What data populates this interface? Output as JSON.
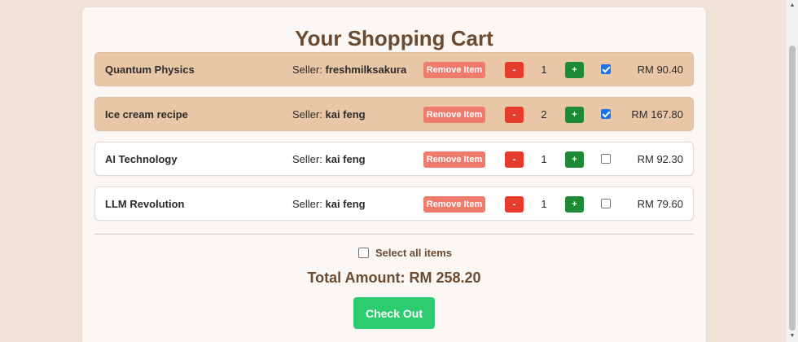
{
  "cart": {
    "title": "Your Shopping Cart",
    "seller_prefix": "Seller:",
    "remove_label": "Remove Item",
    "minus_label": "-",
    "plus_label": "+",
    "items": [
      {
        "name": "Quantum Physics",
        "seller": "freshmilksakura",
        "quantity": "1",
        "price": "RM 90.40",
        "selected": true
      },
      {
        "name": "Ice cream recipe",
        "seller": "kai feng",
        "quantity": "2",
        "price": "RM 167.80",
        "selected": true
      },
      {
        "name": "AI Technology",
        "seller": "kai feng",
        "quantity": "1",
        "price": "RM 92.30",
        "selected": false
      },
      {
        "name": "LLM Revolution",
        "seller": "kai feng",
        "quantity": "1",
        "price": "RM 79.60",
        "selected": false
      }
    ],
    "select_all_label": "Select all items",
    "select_all_checked": false,
    "total_label": "Total Amount: RM 258.20",
    "checkout_label": "Check Out"
  },
  "colors": {
    "page_background": "#f1e4d8",
    "selected_row": "#e8c6a6",
    "heading_brown": "#6b4a2f",
    "remove_button": "#ee7b6c",
    "minus_button": "#e53c2e",
    "plus_button": "#1f8a36",
    "checkout_button": "#2ecc71",
    "checkbox_checked": "#1a73e8"
  },
  "icons": {
    "scroll_up": "triangle-up-icon",
    "scroll_down": "triangle-down-icon",
    "checkmark": "checkmark-icon"
  }
}
